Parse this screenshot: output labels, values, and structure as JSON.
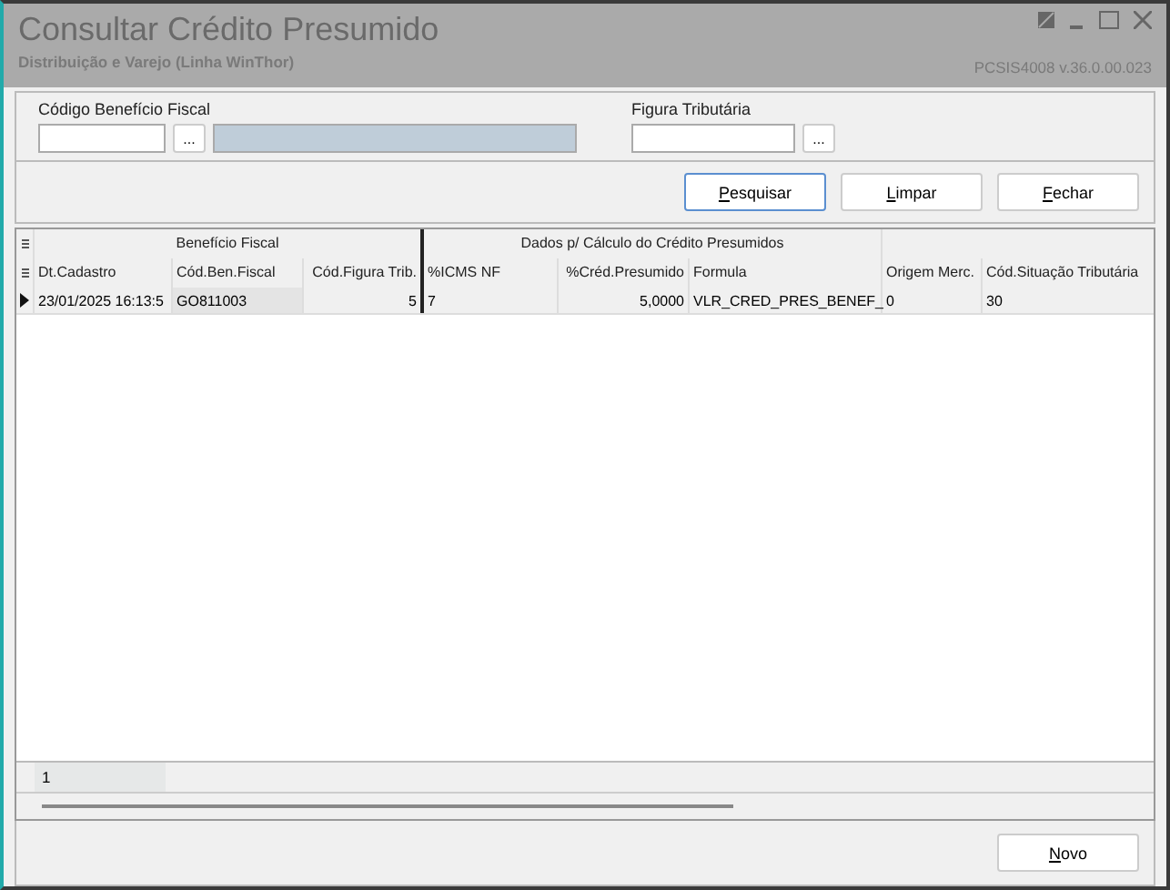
{
  "window": {
    "title": "Consultar Crédito Presumido",
    "subtitle": "Distribuição e Varejo (Linha WinThor)",
    "version": "PCSIS4008  v.36.0.00.023"
  },
  "filters": {
    "beneficio_label": "Código Benefício Fiscal",
    "beneficio_button": "...",
    "figura_label": "Figura Tributária",
    "figura_button": "..."
  },
  "actions": [
    {
      "label": "Pesquisar",
      "selected": true
    },
    {
      "label": "Limpar",
      "selected": false
    },
    {
      "label": "Fechar",
      "selected": false
    }
  ],
  "table": {
    "bands": [
      "Benefício Fiscal",
      "Dados p/ Cálculo do Crédito Presumidos"
    ],
    "columns": [
      "Dt.Cadastro",
      "Cód.Ben.Fiscal",
      "Cód.Figura Trib.",
      "%ICMS NF",
      "%Créd.Presumido",
      "Formula",
      "Origem Merc.",
      "Cód.Situação Tributária"
    ],
    "rows": [
      {
        "selected": true,
        "cells": [
          "23/01/2025 16:13:5",
          "GO811003",
          "5",
          "7",
          "5,0000",
          "VLR_CRED_PRES_BENEF_",
          "0",
          "30"
        ]
      }
    ]
  },
  "footer_count": "1",
  "bottom_buttons": [
    "Novo"
  ]
}
